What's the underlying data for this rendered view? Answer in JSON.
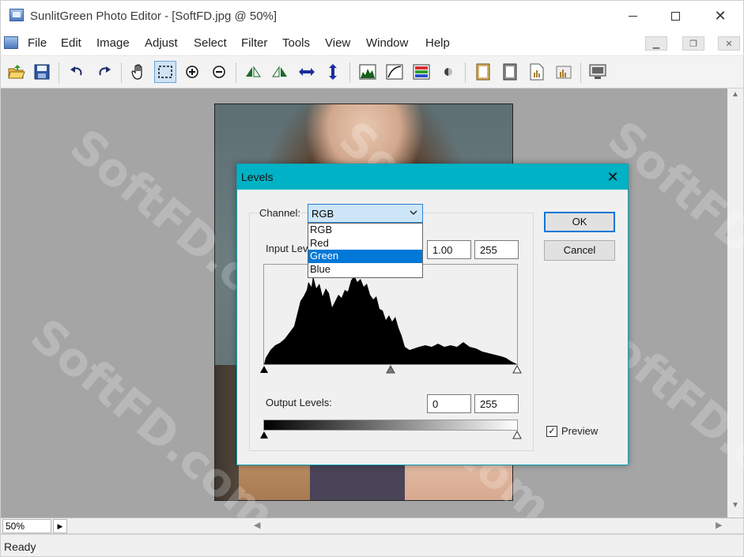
{
  "window": {
    "title": "SunlitGreen Photo Editor - [SoftFD.jpg @ 50%]",
    "minimize_symbol": "",
    "close_symbol": "✕"
  },
  "menu": {
    "items": [
      "File",
      "Edit",
      "Image",
      "Adjust",
      "Select",
      "Filter",
      "Tools",
      "View",
      "Window",
      "Help"
    ],
    "mdi_minimize": "▁",
    "mdi_restore": "❐",
    "mdi_close": "✕"
  },
  "toolbar": {
    "icons": [
      "open-folder-icon",
      "save-icon",
      "undo-icon",
      "redo-icon",
      "hand-pan-icon",
      "rect-select-icon",
      "zoom-in-icon",
      "zoom-out-icon",
      "flip-left-icon",
      "flip-right-icon",
      "flip-horizontal-icon",
      "flip-vertical-icon",
      "levels-icon",
      "curves-icon",
      "color-balance-icon",
      "brightness-icon",
      "frame-icon",
      "frame2-icon",
      "document-icon",
      "histogram-icon",
      "monitor-icon"
    ]
  },
  "zoom": {
    "value": "50%"
  },
  "status": {
    "text": "Ready"
  },
  "watermark": {
    "text": "SoftFD.com"
  },
  "dialog": {
    "title": "Levels",
    "channel_label": "Channel:",
    "channel_selected": "RGB",
    "channel_options": [
      "RGB",
      "Red",
      "Green",
      "Blue"
    ],
    "channel_highlighted": "Green",
    "input_levels_label": "Input Lev",
    "input_values": [
      "1.00",
      "255"
    ],
    "output_levels_label": "Output Levels:",
    "output_values": [
      "0",
      "255"
    ],
    "ok_label": "OK",
    "cancel_label": "Cancel",
    "preview_label": "Preview",
    "preview_checked": "✓"
  }
}
